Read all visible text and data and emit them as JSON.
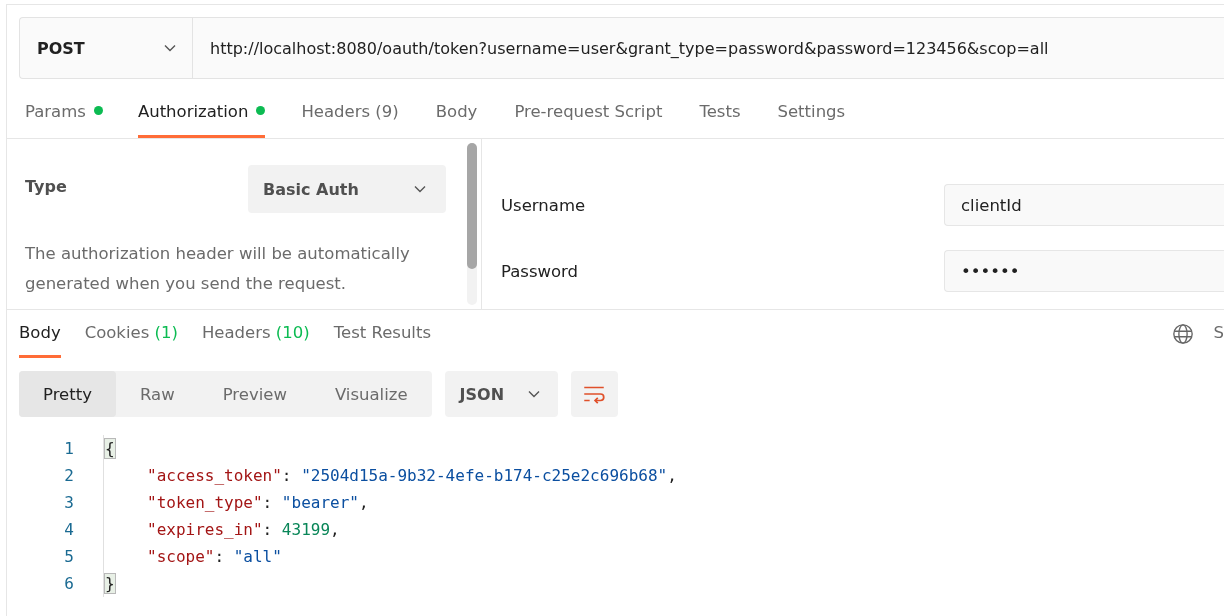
{
  "request": {
    "method": "POST",
    "url": "http://localhost:8080/oauth/token?username=user&grant_type=password&password=123456&scop=all"
  },
  "request_tabs": [
    {
      "label": "Params",
      "dot": true,
      "selected": false
    },
    {
      "label": "Authorization",
      "dot": true,
      "selected": true
    },
    {
      "label": "Headers",
      "count": "(9)",
      "dot": false,
      "selected": false
    },
    {
      "label": "Body",
      "dot": false,
      "selected": false
    },
    {
      "label": "Pre-request Script",
      "dot": false,
      "selected": false
    },
    {
      "label": "Tests",
      "dot": false,
      "selected": false
    },
    {
      "label": "Settings",
      "dot": false,
      "selected": false
    }
  ],
  "auth": {
    "type_label": "Type",
    "type_value": "Basic Auth",
    "description": "The authorization header will be automatically generated when you send the request.",
    "fields": [
      {
        "label": "Username",
        "value": "clientId"
      },
      {
        "label": "Password",
        "value": "••••••"
      }
    ]
  },
  "response_tabs": [
    {
      "label": "Body",
      "selected": true
    },
    {
      "label": "Cookies",
      "count": "(1)",
      "selected": false
    },
    {
      "label": "Headers",
      "count": "(10)",
      "selected": false
    },
    {
      "label": "Test Results",
      "selected": false
    }
  ],
  "response_status_cut": "S",
  "view_modes": [
    {
      "label": "Pretty",
      "selected": true
    },
    {
      "label": "Raw",
      "selected": false
    },
    {
      "label": "Preview",
      "selected": false
    },
    {
      "label": "Visualize",
      "selected": false
    }
  ],
  "format": "JSON",
  "code_lines": [
    {
      "number": "1",
      "indented": false,
      "tokens": [
        {
          "kind": "brace",
          "text": "{"
        }
      ]
    },
    {
      "number": "2",
      "indented": true,
      "tokens": [
        {
          "kind": "key",
          "text": "\"access_token\""
        },
        {
          "kind": "punct",
          "text": ": "
        },
        {
          "kind": "string",
          "text": "\"2504d15a-9b32-4efe-b174-c25e2c696b68\""
        },
        {
          "kind": "punct",
          "text": ","
        }
      ]
    },
    {
      "number": "3",
      "indented": true,
      "tokens": [
        {
          "kind": "key",
          "text": "\"token_type\""
        },
        {
          "kind": "punct",
          "text": ": "
        },
        {
          "kind": "string",
          "text": "\"bearer\""
        },
        {
          "kind": "punct",
          "text": ","
        }
      ]
    },
    {
      "number": "4",
      "indented": true,
      "tokens": [
        {
          "kind": "key",
          "text": "\"expires_in\""
        },
        {
          "kind": "punct",
          "text": ": "
        },
        {
          "kind": "number",
          "text": "43199"
        },
        {
          "kind": "punct",
          "text": ","
        }
      ]
    },
    {
      "number": "5",
      "indented": true,
      "tokens": [
        {
          "kind": "key",
          "text": "\"scope\""
        },
        {
          "kind": "punct",
          "text": ": "
        },
        {
          "kind": "string",
          "text": "\"all\""
        }
      ]
    },
    {
      "number": "6",
      "indented": false,
      "tokens": [
        {
          "kind": "brace",
          "text": "}"
        }
      ]
    }
  ]
}
